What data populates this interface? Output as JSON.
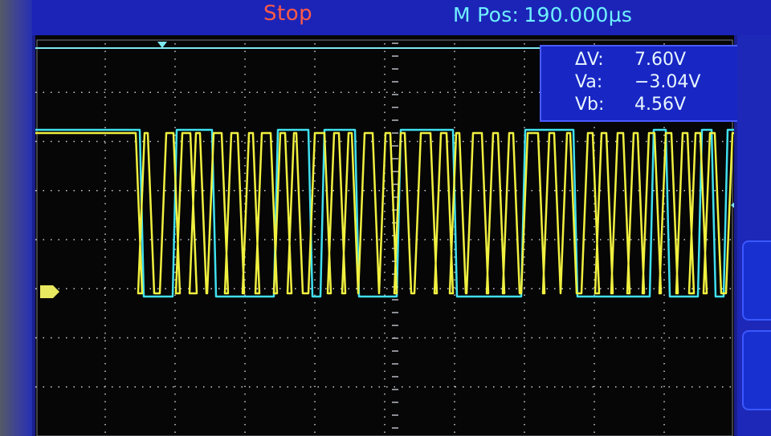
{
  "header": {
    "run_state": "Stop",
    "position_label": "M Pos:",
    "position_value": "190.000µs"
  },
  "cursors": [
    {
      "label": "ΔV:",
      "value": "7.60V"
    },
    {
      "label": "Va:",
      "value": "−3.04V"
    },
    {
      "label": "Vb:",
      "value": "4.56V"
    }
  ],
  "markers": {
    "trigger_position": "trigger-position-marker",
    "channel_ground": "channel-ground-marker",
    "trigger_level": "trigger-level-marker"
  },
  "colors": {
    "channel1": "#f0f040",
    "channel2": "#40e0f0",
    "run_state": "#ff5a45",
    "header_text": "#6ff0ff",
    "panel": "#1826c4"
  },
  "traces": {
    "channel1_high_segments": [
      [
        0,
        125
      ],
      [
        136,
        140
      ],
      [
        163,
        172
      ],
      [
        183,
        193
      ],
      [
        200,
        205
      ],
      [
        222,
        232
      ],
      [
        244,
        252
      ],
      [
        266,
        271
      ],
      [
        282,
        293
      ],
      [
        305,
        311
      ],
      [
        322,
        325
      ],
      [
        348,
        360
      ],
      [
        372,
        378
      ],
      [
        390,
        394
      ],
      [
        410,
        420
      ],
      [
        436,
        442
      ],
      [
        455,
        460
      ],
      [
        480,
        492
      ],
      [
        505,
        512
      ],
      [
        524,
        528
      ],
      [
        545,
        556
      ],
      [
        570,
        576
      ],
      [
        590,
        595
      ],
      [
        613,
        626
      ],
      [
        640,
        646
      ],
      [
        662,
        666
      ],
      [
        688,
        694
      ],
      [
        705,
        711
      ],
      [
        725,
        732
      ],
      [
        745,
        750
      ],
      [
        764,
        771
      ],
      [
        785,
        792
      ],
      [
        806,
        812
      ],
      [
        822,
        828
      ],
      [
        840,
        846
      ],
      [
        868,
        900
      ]
    ],
    "channel2_high_segments": [
      [
        0,
        130
      ],
      [
        176,
        220
      ],
      [
        302,
        340
      ],
      [
        360,
        398
      ],
      [
        455,
        520
      ],
      [
        610,
        670
      ],
      [
        770,
        785
      ],
      [
        830,
        842
      ],
      [
        862,
        900
      ]
    ]
  }
}
